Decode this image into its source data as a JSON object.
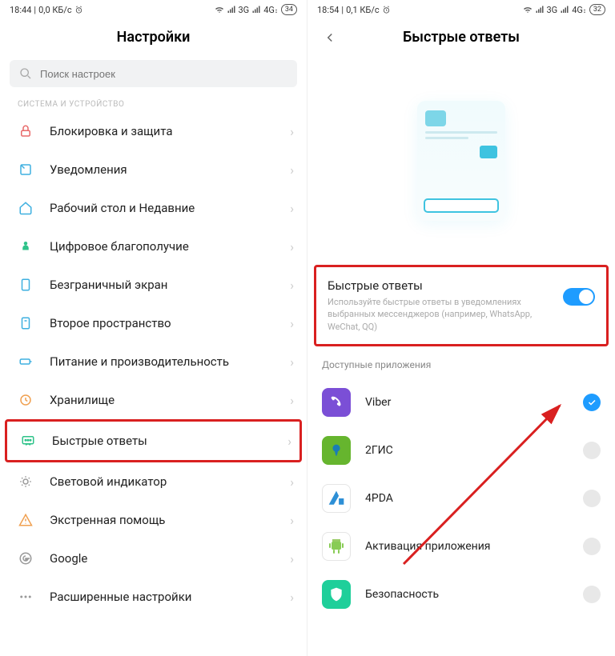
{
  "left": {
    "status": {
      "time": "18:44",
      "data_rate": "0,0 КБ/с",
      "net1": "3G",
      "net2": "4G",
      "battery": "34"
    },
    "title": "Настройки",
    "search_placeholder": "Поиск настроек",
    "section_header": "СИСТЕМА И УСТРОЙСТВО",
    "items": [
      {
        "label": "Блокировка и защита",
        "icon": "lock-icon",
        "color": "#e86a6a"
      },
      {
        "label": "Уведомления",
        "icon": "notification-icon",
        "color": "#3fb0e0"
      },
      {
        "label": "Рабочий стол и Недавние",
        "icon": "home-icon",
        "color": "#3fb0e0"
      },
      {
        "label": "Цифровое благополучие",
        "icon": "wellbeing-icon",
        "color": "#2fc38a"
      },
      {
        "label": "Безграничный экран",
        "icon": "fullscreen-icon",
        "color": "#3fb0e0"
      },
      {
        "label": "Второе пространство",
        "icon": "second-space-icon",
        "color": "#3fb0e0"
      },
      {
        "label": "Питание и производительность",
        "icon": "battery-icon",
        "color": "#3fb0e0"
      },
      {
        "label": "Хранилище",
        "icon": "storage-icon",
        "color": "#f0a050"
      },
      {
        "label": "Быстрые ответы",
        "icon": "quick-reply-icon",
        "color": "#2fc38a",
        "highlight": true
      },
      {
        "label": "Световой индикатор",
        "icon": "led-icon",
        "color": "#999"
      },
      {
        "label": "Экстренная помощь",
        "icon": "emergency-icon",
        "color": "#f0a050"
      },
      {
        "label": "Google",
        "icon": "google-icon",
        "color": "#999"
      },
      {
        "label": "Расширенные настройки",
        "icon": "advanced-icon",
        "color": "#999"
      }
    ]
  },
  "right": {
    "status": {
      "time": "18:54",
      "data_rate": "0,1 КБ/с",
      "net1": "3G",
      "net2": "4G",
      "battery": "32"
    },
    "title": "Быстрые ответы",
    "toggle": {
      "title": "Быстрые ответы",
      "desc": "Используйте быстрые ответы в уведомлениях выбранных мессенджеров (например, WhatsApp, WeChat, QQ)",
      "enabled": true
    },
    "apps_header": "Доступные приложения",
    "apps": [
      {
        "label": "Viber",
        "selected": true,
        "bg": "#7b4fd6"
      },
      {
        "label": "2ГИС",
        "selected": false,
        "bg": "#66b52e"
      },
      {
        "label": "4PDA",
        "selected": false,
        "bg": "#ffffff"
      },
      {
        "label": "Активация приложения",
        "selected": false,
        "bg": "#ffffff"
      },
      {
        "label": "Безопасность",
        "selected": false,
        "bg": "#1fcf9a"
      }
    ]
  }
}
